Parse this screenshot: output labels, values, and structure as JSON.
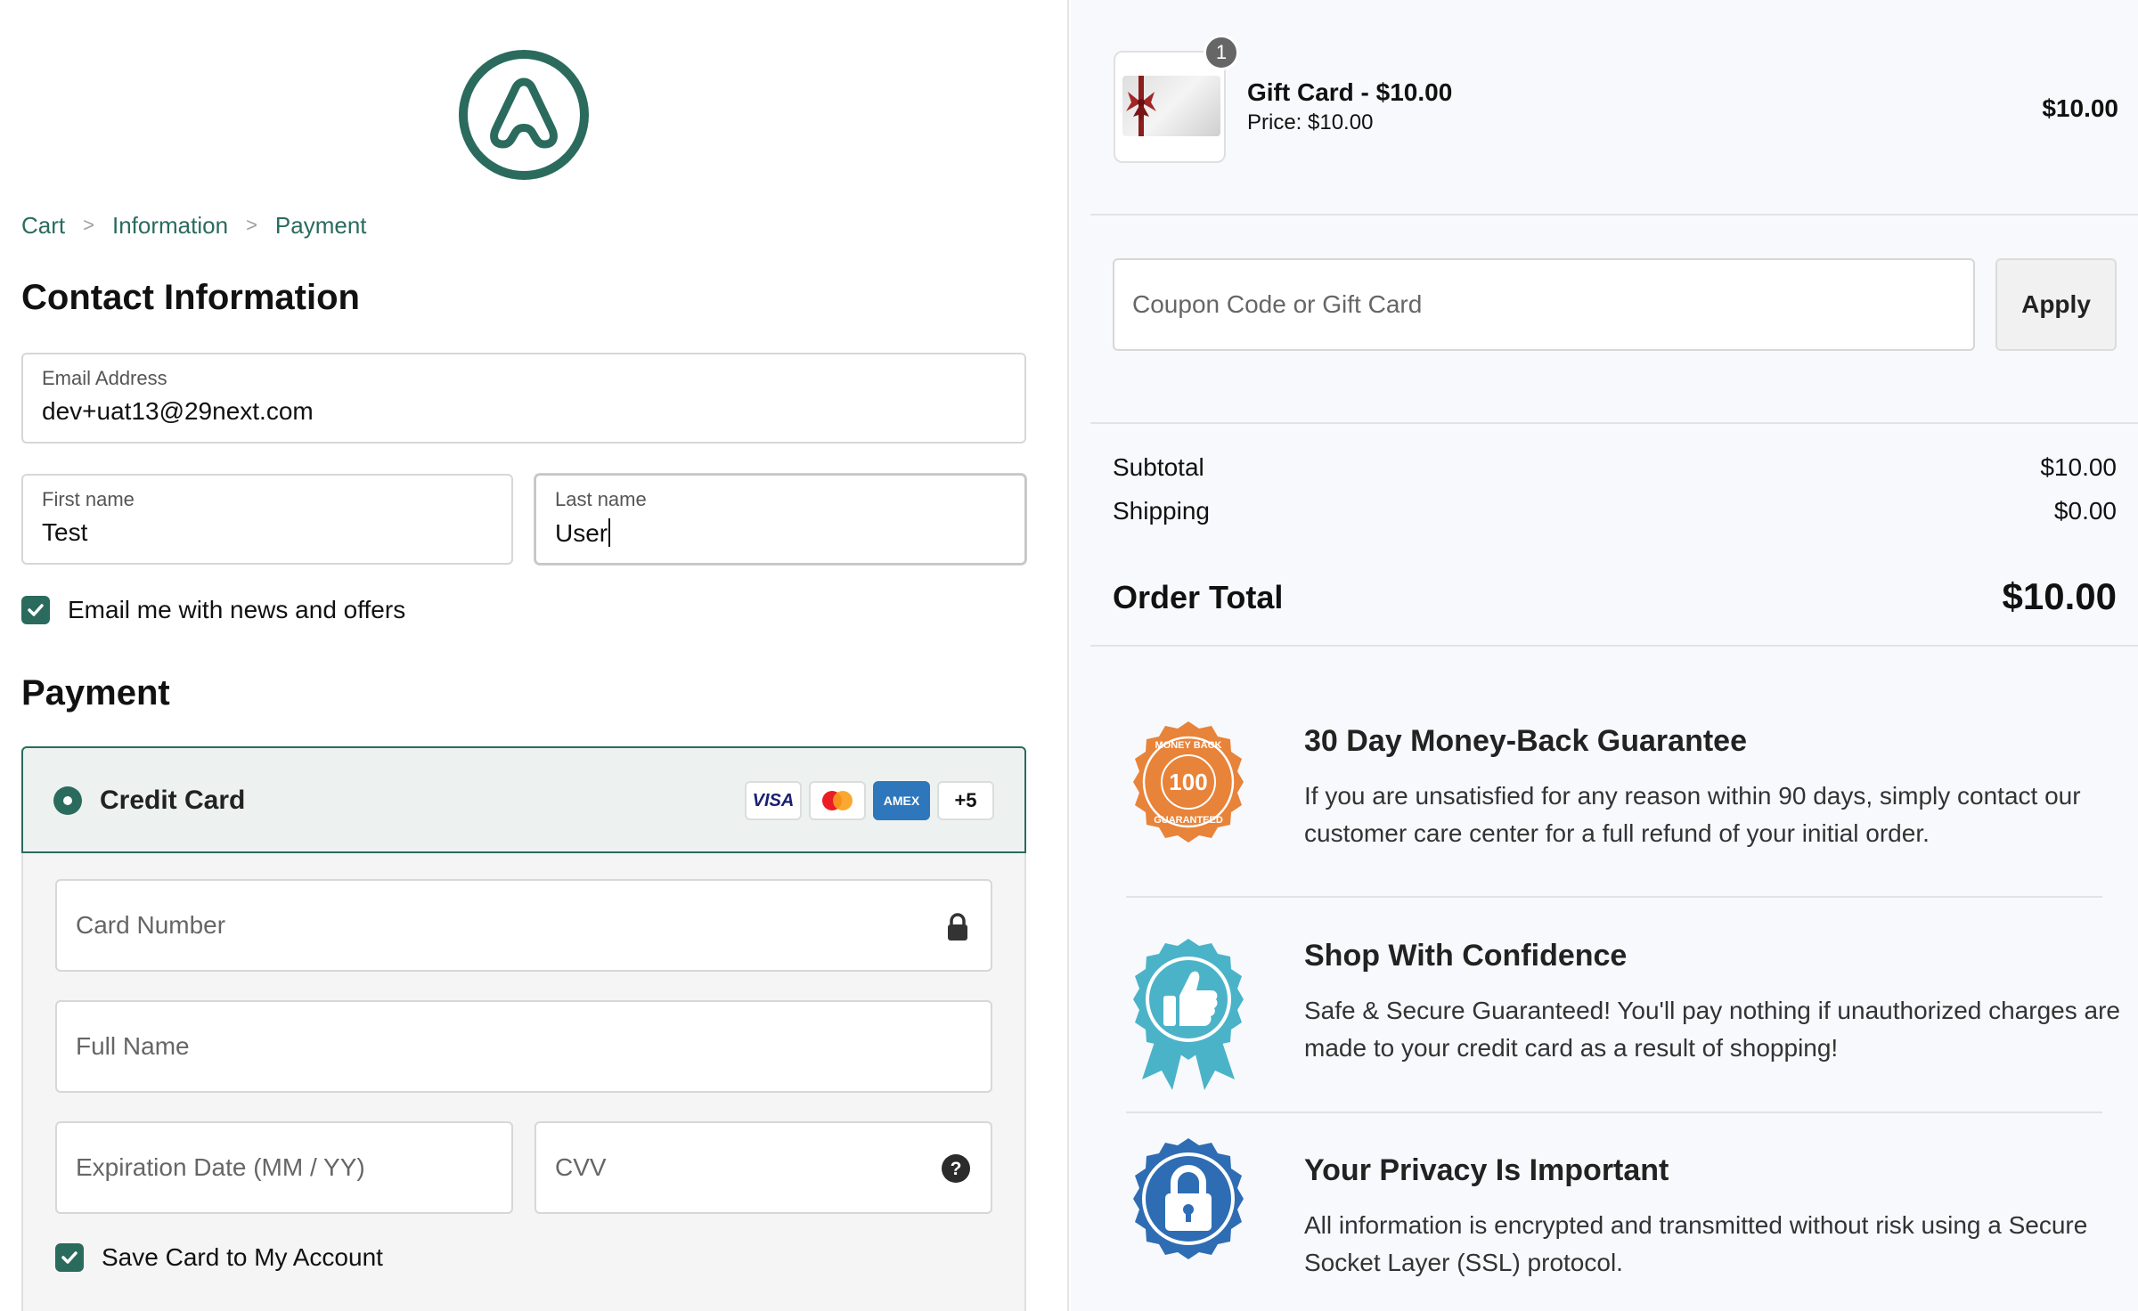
{
  "breadcrumb": {
    "items": [
      "Cart",
      "Information",
      "Payment"
    ],
    "separator": ">"
  },
  "contact": {
    "title": "Contact Information",
    "email": {
      "label": "Email Address",
      "value": "dev+uat13@29next.com"
    },
    "first_name": {
      "label": "First name",
      "value": "Test"
    },
    "last_name": {
      "label": "Last name",
      "value": "User"
    },
    "newsletter": {
      "label": "Email me with news and offers",
      "checked": true
    }
  },
  "payment": {
    "title": "Payment",
    "method_label": "Credit Card",
    "card_icons": [
      "visa-icon",
      "mastercard-icon",
      "amex-icon"
    ],
    "visa_text": "VISA",
    "amex_text": "AMEX",
    "more_cards": "+5",
    "card_number_placeholder": "Card Number",
    "full_name_placeholder": "Full Name",
    "expiration_placeholder": "Expiration Date (MM / YY)",
    "cvv_placeholder": "CVV",
    "save_card": {
      "label": "Save Card to My Account",
      "checked": true
    }
  },
  "cart": {
    "item": {
      "name": "Gift Card - $10.00",
      "price_line": "Price: $10.00",
      "quantity": "1",
      "line_total": "$10.00"
    },
    "coupon_placeholder": "Coupon Code or Gift Card",
    "apply_label": "Apply",
    "subtotal_label": "Subtotal",
    "subtotal_value": "$10.00",
    "shipping_label": "Shipping",
    "shipping_value": "$0.00",
    "total_label": "Order Total",
    "total_value": "$10.00"
  },
  "guarantees": [
    {
      "title": "30 Day Money-Back Guarantee",
      "text": "If you are unsatisfied for any reason within 90 days, simply contact our customer care center for a full refund of your initial order.",
      "icon": "money-back-badge-icon",
      "badge_text": "100",
      "badge_top": "MONEY BACK",
      "badge_bottom": "GUARANTEED"
    },
    {
      "title": "Shop With Confidence",
      "text": "Safe & Secure Guaranteed! You'll pay nothing if unauthorized charges are made to your credit card as a result of shopping!",
      "icon": "thumbs-up-ribbon-icon"
    },
    {
      "title": "Your Privacy Is Important",
      "text": "All information is encrypted and transmitted without risk using a Secure Socket Layer (SSL) protocol.",
      "icon": "padlock-badge-icon"
    }
  ],
  "colors": {
    "accent": "#2a6b5e",
    "badge_orange": "#e8833a",
    "ribbon_teal": "#4bb3c8",
    "lock_blue": "#2e6db4"
  }
}
